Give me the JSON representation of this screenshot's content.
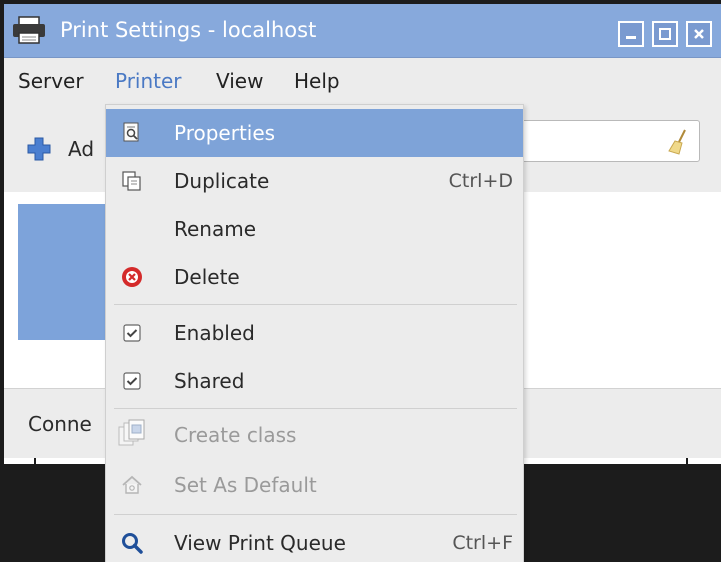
{
  "window": {
    "title": "Print Settings - localhost",
    "accent": "#87a9dc"
  },
  "menubar": {
    "items": [
      {
        "label": "Server"
      },
      {
        "label": "Printer"
      },
      {
        "label": "View"
      },
      {
        "label": "Help"
      }
    ],
    "active": "Printer"
  },
  "toolbar": {
    "add_label": "Ad",
    "search_value": ""
  },
  "statusbar": {
    "label": "Conne"
  },
  "printer_menu": {
    "items": [
      {
        "label": "Properties",
        "icon": "properties-icon",
        "highlighted": true
      },
      {
        "label": "Duplicate",
        "icon": "duplicate-icon",
        "accel": "Ctrl+D"
      },
      {
        "label": "Rename"
      },
      {
        "label": "Delete",
        "icon": "delete-icon"
      },
      {
        "label": "Enabled",
        "icon": "checkbox-checked-icon",
        "checked": true
      },
      {
        "label": "Shared",
        "icon": "checkbox-checked-icon",
        "checked": true
      },
      {
        "label": "Create class",
        "icon": "create-class-icon",
        "disabled": true
      },
      {
        "label": "Set As Default",
        "icon": "home-icon",
        "disabled": true
      },
      {
        "label": "View Print Queue",
        "icon": "search-icon",
        "accel": "Ctrl+F"
      }
    ]
  }
}
